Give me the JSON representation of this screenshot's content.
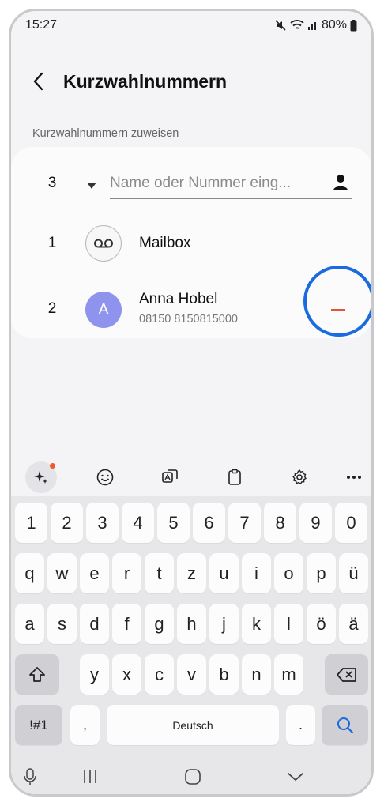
{
  "status_bar": {
    "time": "15:27",
    "battery": "80%"
  },
  "header": {
    "title": "Kurzwahlnummern"
  },
  "section_label": "Kurzwahlnummern zuweisen",
  "assign_row": {
    "number": "3",
    "placeholder": "Name oder Nummer eing..."
  },
  "entries": [
    {
      "number": "1",
      "name": "Mailbox",
      "icon": "voicemail-icon"
    },
    {
      "number": "2",
      "name": "Anna Hobel",
      "initial": "A",
      "phone": "08150 8150815000",
      "avatar_color": "#8e93ee"
    }
  ],
  "colors": {
    "remove_accent": "#e0553a",
    "highlight_ring": "#1a6ae0",
    "notification_dot": "#ee5a2a"
  },
  "keyboard": {
    "toolbar": [
      "ai-sparkle-icon",
      "emoji-icon",
      "translate-icon",
      "clipboard-icon",
      "settings-icon",
      "more-icon"
    ],
    "row_numbers": [
      "1",
      "2",
      "3",
      "4",
      "5",
      "6",
      "7",
      "8",
      "9",
      "0"
    ],
    "row1": [
      "q",
      "w",
      "e",
      "r",
      "t",
      "z",
      "u",
      "i",
      "o",
      "p",
      "ü"
    ],
    "row2": [
      "a",
      "s",
      "d",
      "f",
      "g",
      "h",
      "j",
      "k",
      "l",
      "ö",
      "ä"
    ],
    "row3": [
      "y",
      "x",
      "c",
      "v",
      "b",
      "n",
      "m"
    ],
    "symbols_key": "!#1",
    "comma_key": ",",
    "space_label": "Deutsch",
    "period_key": "."
  }
}
